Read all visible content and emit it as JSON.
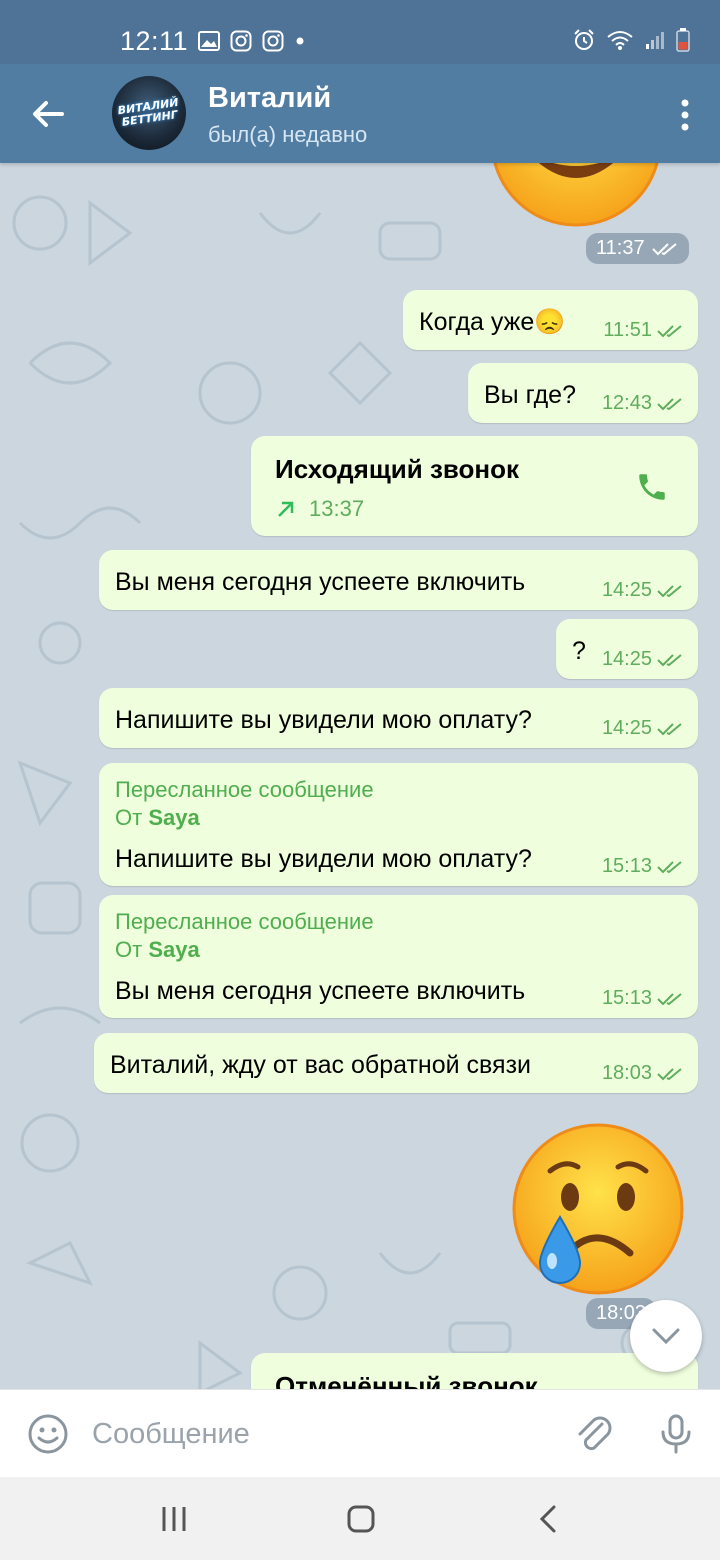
{
  "status_bar": {
    "time": "12:11",
    "left_icons": [
      "gallery-icon",
      "instagram-icon",
      "instagram-icon",
      "dot-icon"
    ],
    "right_icons": [
      "alarm-icon",
      "wifi-icon",
      "signal-icon",
      "battery-low-icon"
    ]
  },
  "header": {
    "name": "Виталий",
    "status": "был(а) недавно",
    "avatar_text": "ВИТАЛИЙ БЕТТИНГ"
  },
  "colors": {
    "header": "#517da2",
    "status_bar": "#4f7297",
    "bubble_out": "#effedd",
    "accent_green": "#4fae4e",
    "chat_bg": "#cbd6de"
  },
  "messages": [
    {
      "type": "sticker",
      "emoji": "smiling-face",
      "time": "11:37"
    },
    {
      "type": "text",
      "text": "Когда уже😞",
      "time": "11:51"
    },
    {
      "type": "text",
      "text": "Вы где?",
      "time": "12:43"
    },
    {
      "type": "call",
      "title": "Исходящий звонок",
      "time": "13:37"
    },
    {
      "type": "text",
      "text": "Вы меня сегодня успеете включить",
      "time": "14:25"
    },
    {
      "type": "text",
      "text": "?",
      "time": "14:25"
    },
    {
      "type": "text",
      "text": "Напишите вы увидели мою оплату?",
      "time": "14:25"
    },
    {
      "type": "forwarded",
      "header": "Пересланное сообщение",
      "from_prefix": "От",
      "from": "Saya",
      "text": "Напишите вы увидели мою оплату?",
      "time": "15:13"
    },
    {
      "type": "forwarded",
      "header": "Пересланное сообщение",
      "from_prefix": "От",
      "from": "Saya",
      "text": "Вы меня сегодня успеете включить",
      "time": "15:13"
    },
    {
      "type": "text",
      "text": "Виталий, жду от вас обратной связи",
      "time": "18:03"
    },
    {
      "type": "sticker",
      "emoji": "crying-face",
      "time": "18:03"
    },
    {
      "type": "call",
      "title": "Отменённый звонок",
      "time": ""
    }
  ],
  "input": {
    "placeholder": "Сообщение"
  }
}
